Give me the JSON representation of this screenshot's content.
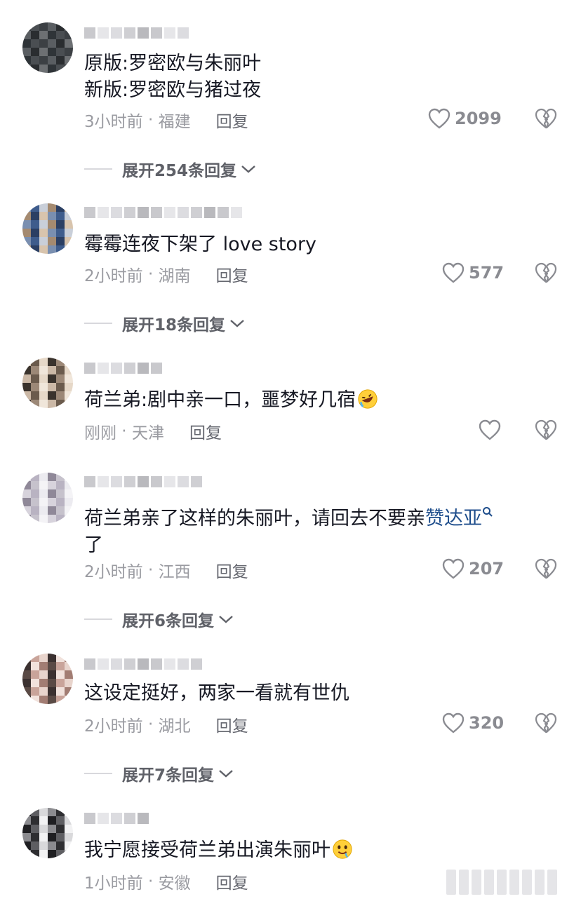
{
  "comments": [
    {
      "avatar_colors": [
        "#2f3438",
        "#4a4e52",
        "#3c4044",
        "#5a5e62",
        "#2a2d30",
        "#6d7073"
      ],
      "text_lines": [
        "原版:罗密欧与朱丽叶",
        "新版:罗密欧与猪过夜"
      ],
      "time": "3小时前",
      "location": "福建",
      "reply_label": "回复",
      "likes": "2099",
      "expand_label": "展开254条回复"
    },
    {
      "avatar_colors": [
        "#7a8fb0",
        "#3e5c8c",
        "#c9cfd9",
        "#a48a70",
        "#2b3f63",
        "#d8c4ad"
      ],
      "text_lines": [
        "霉霉连夜下架了 love story"
      ],
      "time": "2小时前",
      "location": "湖南",
      "reply_label": "回复",
      "likes": "577",
      "expand_label": "展开18条回复"
    },
    {
      "avatar_colors": [
        "#cbb8a6",
        "#6b5b4d",
        "#e6d8c8",
        "#3a332d",
        "#9c8877",
        "#f0e6da"
      ],
      "text_lines": [
        "荷兰弟:剧中亲一口，噩梦好几宿"
      ],
      "emoji": "rofl-emoji",
      "time": "刚刚",
      "location": "天津",
      "reply_label": "回复",
      "likes": "",
      "expand_label": ""
    },
    {
      "avatar_colors": [
        "#d7d3dc",
        "#b9b3c2",
        "#ecebf0",
        "#8f8898",
        "#c6c2cc",
        "#f4f3f6"
      ],
      "text_line_1_prefix": "荷兰弟亲了这样的朱丽叶，请回去不要亲",
      "text_link": "赞达亚",
      "search_mark": "Q",
      "text_line_2": "了",
      "time": "2小时前",
      "location": "江西",
      "reply_label": "回复",
      "likes": "207",
      "expand_label": "展开6条回复"
    },
    {
      "avatar_colors": [
        "#5a4a45",
        "#c9a49a",
        "#e8d4cc",
        "#3b3130",
        "#f1e2dc",
        "#a27d73"
      ],
      "text_lines": [
        "这设定挺好，两家一看就有世仇"
      ],
      "time": "2小时前",
      "location": "湖北",
      "reply_label": "回复",
      "likes": "320",
      "expand_label": "展开7条回复"
    },
    {
      "avatar_colors": [
        "#1f1f22",
        "#5e5e62",
        "#d9d9db",
        "#8b8b8f",
        "#2e2e31",
        "#f2f2f3"
      ],
      "text_lines": [
        "我宁愿接受荷兰弟出演朱丽叶"
      ],
      "emoji": "drooling-emoji",
      "time": "1小时前",
      "location": "安徽",
      "reply_label": "回复",
      "likes": "",
      "expand_label": ""
    }
  ],
  "colors": {
    "text": "#161823",
    "meta": "#9a9ba1",
    "link": "#1f4e8c"
  }
}
